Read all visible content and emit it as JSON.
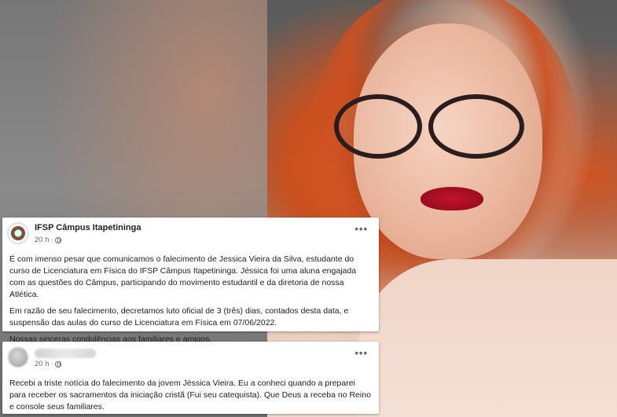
{
  "post": {
    "page_name": "IFSP Câmpus Itapetininga",
    "time": "20 h",
    "separator": "·",
    "more": "•••",
    "paragraphs": [
      "É com imenso pesar que comunicamos o falecimento de Jessica Vieira da Silva, estudante do curso de Licenciatura em Física do IFSP Câmpus Itapetininga. Jéssica foi uma aluna engajada com as questões do Câmpus, participando do movimento estudantil e da diretoria de nossa Atlética.",
      "Em razão de seu falecimento, decretamos luto oficial de 3 (três) dias, contados desta data, e suspensão das aulas do curso de Licenciatura em Física em 07/06/2022.",
      "Nossas sinceras condolências aos familiares e amigos."
    ]
  },
  "comment": {
    "time": "20 h",
    "separator": "·",
    "more": "•••",
    "text": "Recebi a triste notícia do falecimento da jovem Jéssica Vieira. Eu a conheci quando a preparei para receber os sacramentos da iniciação cristã (Fui seu catequista). Que Deus a receba no Reino e console seus familiares."
  },
  "icons": {
    "privacy": "globe-icon",
    "options": "more-options-icon",
    "page_logo": "ifsp-logo-icon"
  }
}
